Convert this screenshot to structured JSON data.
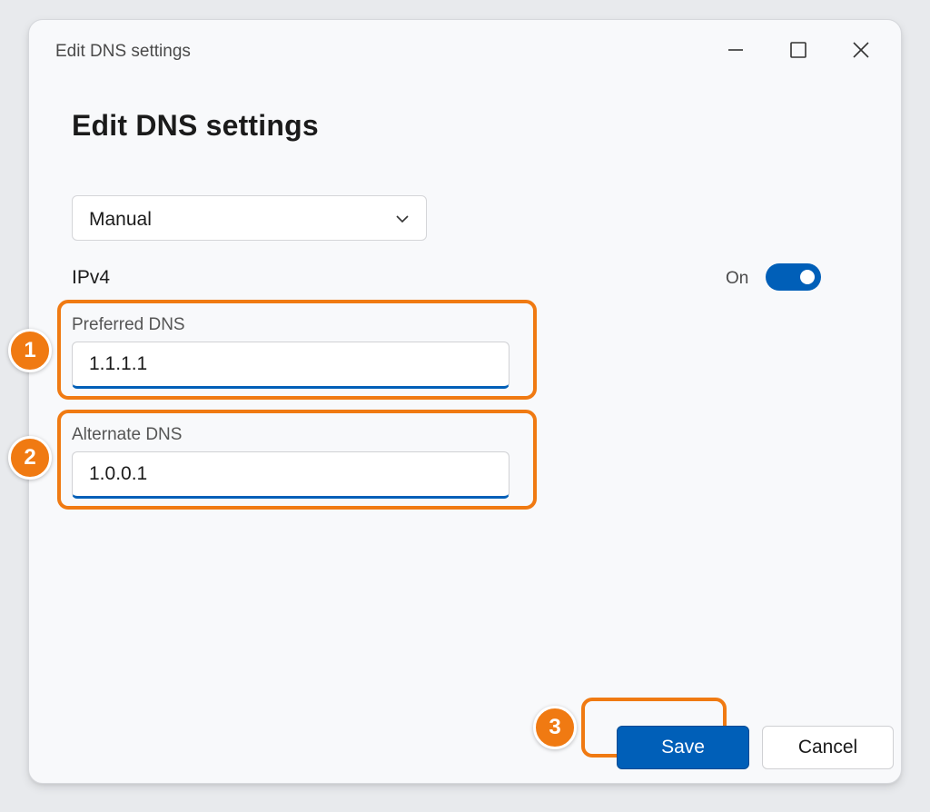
{
  "window": {
    "title": "Edit DNS settings",
    "controls": {
      "minimize": "minimize-icon",
      "maximize": "maximize-icon",
      "close": "close-icon"
    }
  },
  "dialog": {
    "heading": "Edit DNS settings",
    "mode_dropdown": {
      "selected": "Manual",
      "icon": "chevron-down-icon"
    },
    "ipv4": {
      "label": "IPv4",
      "toggle_state": "On",
      "enabled": true
    },
    "preferred_dns": {
      "label": "Preferred DNS",
      "value": "1.1.1.1"
    },
    "alternate_dns": {
      "label": "Alternate DNS",
      "value": "1.0.0.1"
    },
    "buttons": {
      "save": "Save",
      "cancel": "Cancel"
    }
  },
  "annotations": {
    "step_1": "1",
    "step_2": "2",
    "step_3": "3"
  },
  "colors": {
    "accent": "#005fb8",
    "highlight": "#f07a12"
  }
}
